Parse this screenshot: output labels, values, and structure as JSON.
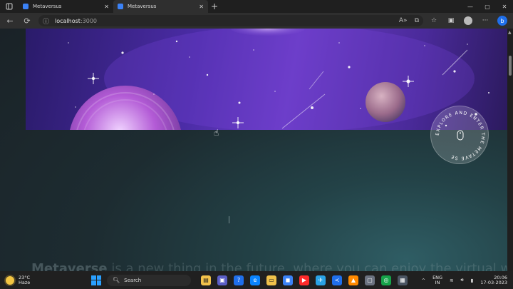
{
  "tabs": [
    {
      "label": "Metaversus",
      "active": false
    },
    {
      "label": "Metaversus",
      "active": true
    }
  ],
  "address": {
    "host": "localhost",
    "port": ":3000"
  },
  "page": {
    "badge_text": "EXPLORE AND ENTER THE METAVE SE",
    "bottom_text_bold": "Metaverse",
    "bottom_text_rest": " is a new thing in the future, where you can enjoy the virtual world"
  },
  "taskbar": {
    "weather_temp": "23°C",
    "weather_desc": "Haze",
    "search_label": "Search",
    "lang_1": "ENG",
    "lang_2": "IN",
    "time": "20:06",
    "date": "17-03-2023"
  },
  "colors": {
    "accent": "#1f6feb",
    "taskbar_bg": "#202020",
    "page_bg": "#1d2c31",
    "hero_purple": "#6a3cc4"
  },
  "icons": {
    "tab_actions": "tab-actions-icon",
    "new_tab": "plus-icon",
    "back": "back-arrow-icon",
    "refresh": "refresh-icon",
    "info": "info-icon",
    "read_aloud": "read-aloud-icon",
    "favorites": "star-icon",
    "collections": "collections-icon",
    "profile": "profile-icon",
    "more": "more-icon",
    "bing": "bing-icon"
  }
}
